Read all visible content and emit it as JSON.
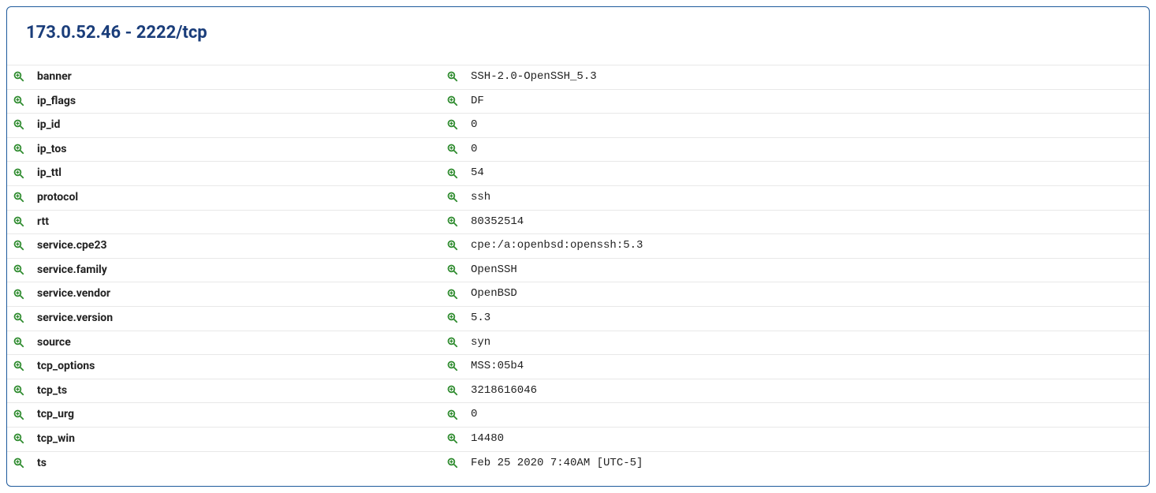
{
  "panel": {
    "title": "173.0.52.46 - 2222/tcp",
    "highlightKey": "banner",
    "rows": [
      {
        "key": "banner",
        "value": "SSH-2.0-OpenSSH_5.3"
      },
      {
        "key": "ip_flags",
        "value": "DF"
      },
      {
        "key": "ip_id",
        "value": "0"
      },
      {
        "key": "ip_tos",
        "value": "0"
      },
      {
        "key": "ip_ttl",
        "value": "54"
      },
      {
        "key": "protocol",
        "value": "ssh"
      },
      {
        "key": "rtt",
        "value": "80352514"
      },
      {
        "key": "service.cpe23",
        "value": "cpe:/a:openbsd:openssh:5.3"
      },
      {
        "key": "service.family",
        "value": "OpenSSH"
      },
      {
        "key": "service.vendor",
        "value": "OpenBSD"
      },
      {
        "key": "service.version",
        "value": "5.3"
      },
      {
        "key": "source",
        "value": "syn"
      },
      {
        "key": "tcp_options",
        "value": "MSS:05b4"
      },
      {
        "key": "tcp_ts",
        "value": "3218616046"
      },
      {
        "key": "tcp_urg",
        "value": "0"
      },
      {
        "key": "tcp_win",
        "value": "14480"
      },
      {
        "key": "ts",
        "value": "Feb 25 2020 7:40AM [UTC-5]"
      }
    ]
  },
  "icons": {
    "magnifyColor": "#2e8b2e"
  }
}
